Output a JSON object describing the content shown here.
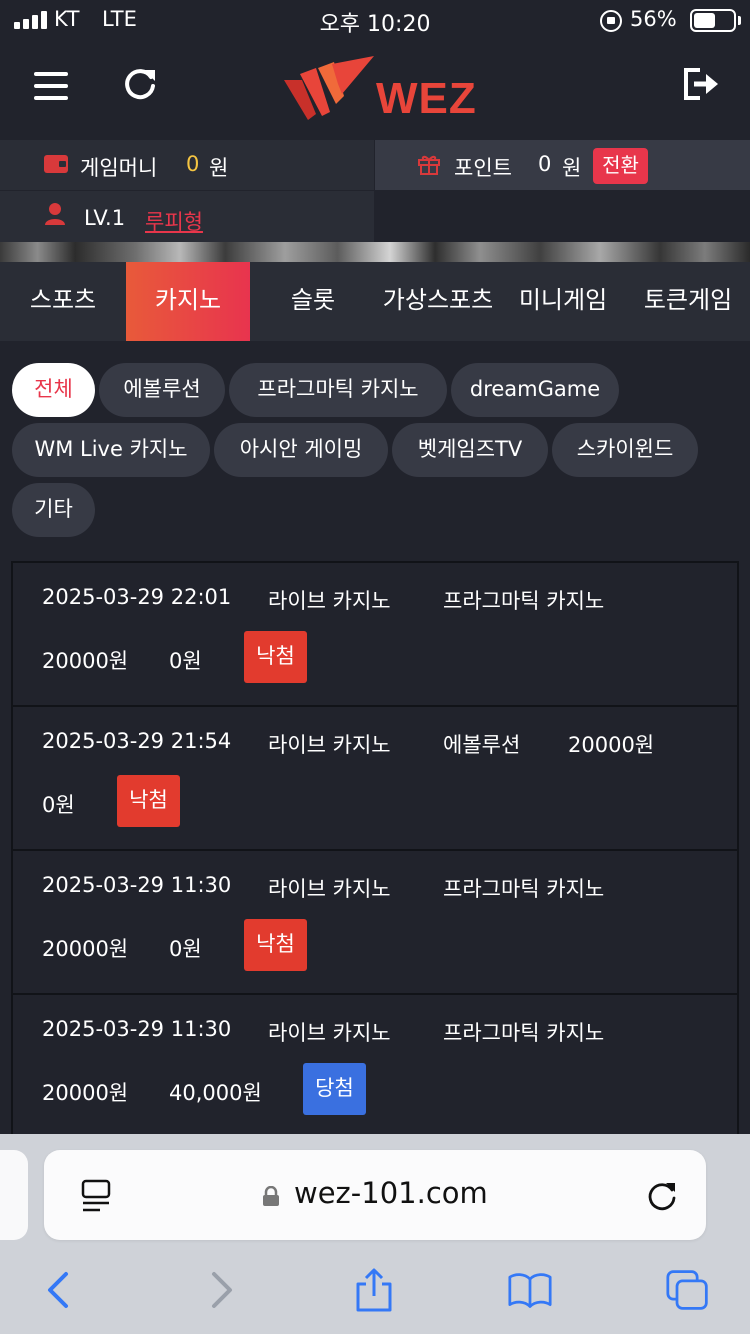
{
  "status_bar": {
    "carrier": "KT",
    "network": "LTE",
    "time": "오후 10:20",
    "battery": "56%",
    "battery_level": 0.56
  },
  "header": {
    "logo_text": "WEZ",
    "icons": [
      "menu-icon",
      "refresh-icon",
      "logout-icon"
    ],
    "brand_color": "#e8453a"
  },
  "user": {
    "money_label": "게임머니",
    "money_value": "0",
    "money_unit": "원",
    "point_label": "포인트",
    "point_value": "0",
    "point_unit": "원",
    "convert_label": "전환",
    "level": "LV.1",
    "nickname": "루피형"
  },
  "tabs": [
    {
      "label": "스포츠",
      "active": false
    },
    {
      "label": "카지노",
      "active": true
    },
    {
      "label": "슬롯",
      "active": false
    },
    {
      "label": "가상스포츠",
      "active": false
    },
    {
      "label": "미니게임",
      "active": false
    },
    {
      "label": "토큰게임",
      "active": false
    }
  ],
  "filters": [
    {
      "label": "전체",
      "active": true
    },
    {
      "label": "에볼루션",
      "active": false
    },
    {
      "label": "프라그마틱 카지노",
      "active": false
    },
    {
      "label": "dreamGame",
      "active": false
    },
    {
      "label": "WM Live 카지노",
      "active": false
    },
    {
      "label": "아시안 게이밍",
      "active": false
    },
    {
      "label": "벳게임즈TV",
      "active": false
    },
    {
      "label": "스카이윈드",
      "active": false
    },
    {
      "label": "기타",
      "active": false
    }
  ],
  "bets": [
    {
      "datetime": "2025-03-29 22:01",
      "category": "라이브 카지노",
      "provider": "프라그마틱 카지노",
      "amount": "20000원",
      "payout": "0원",
      "result": "낙첨",
      "result_type": "lose"
    },
    {
      "datetime": "2025-03-29 21:54",
      "category": "라이브 카지노",
      "provider": "에볼루션",
      "amount": "20000원",
      "payout": "0원",
      "result": "낙첨",
      "result_type": "lose"
    },
    {
      "datetime": "2025-03-29 11:30",
      "category": "라이브 카지노",
      "provider": "프라그마틱 카지노",
      "amount": "20000원",
      "payout": "0원",
      "result": "낙첨",
      "result_type": "lose"
    },
    {
      "datetime": "2025-03-29 11:30",
      "category": "라이브 카지노",
      "provider": "프라그마틱 카지노",
      "amount": "20000원",
      "payout": "40,000원",
      "result": "당첨",
      "result_type": "win"
    }
  ],
  "colors": {
    "lose": "#e23b2e",
    "win": "#3a70e0",
    "accent": "#e8364b",
    "money_value": "#f5c542"
  },
  "browser": {
    "url": "wez-101.com",
    "icons": [
      "reader-icon",
      "lock-icon",
      "reload-icon",
      "back-icon",
      "forward-icon",
      "share-icon",
      "bookmarks-icon",
      "tabs-icon"
    ]
  }
}
